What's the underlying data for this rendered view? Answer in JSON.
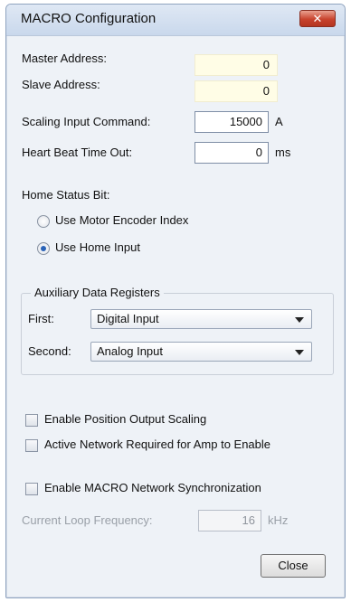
{
  "window": {
    "title": "MACRO Configuration"
  },
  "fields": {
    "master_address_label": "Master Address:",
    "master_address_value": "0",
    "slave_address_label": "Slave Address:",
    "slave_address_value": "0",
    "scaling_input_label": "Scaling Input Command:",
    "scaling_input_value": "15000",
    "scaling_input_unit": "A",
    "heartbeat_label": "Heart Beat Time Out:",
    "heartbeat_value": "0",
    "heartbeat_unit": "ms"
  },
  "home_status": {
    "label": "Home Status Bit:",
    "options": [
      {
        "label": "Use Motor Encoder Index",
        "selected": false
      },
      {
        "label": "Use Home Input",
        "selected": true
      }
    ]
  },
  "aux_registers": {
    "title": "Auxiliary Data Registers",
    "first_label": "First:",
    "first_value": "Digital Input",
    "second_label": "Second:",
    "second_value": "Analog Input"
  },
  "checkboxes": {
    "enable_position_output_scaling": "Enable Position Output Scaling",
    "active_network_required": "Active Network Required for Amp to Enable",
    "enable_macro_sync": "Enable MACRO Network Synchronization"
  },
  "current_loop": {
    "label": "Current Loop Frequency:",
    "value": "16",
    "unit": "kHz"
  },
  "buttons": {
    "close": "Close"
  },
  "colors": {
    "titlebar": "#c9d8ec",
    "dialog_bg": "#eef2f7",
    "close_button": "#c8432d",
    "readonly_field_bg": "#fffde6",
    "radio_selected": "#2a63b7"
  },
  "icons": {
    "close": "close-x-icon",
    "dropdown": "chevron-down-icon"
  }
}
